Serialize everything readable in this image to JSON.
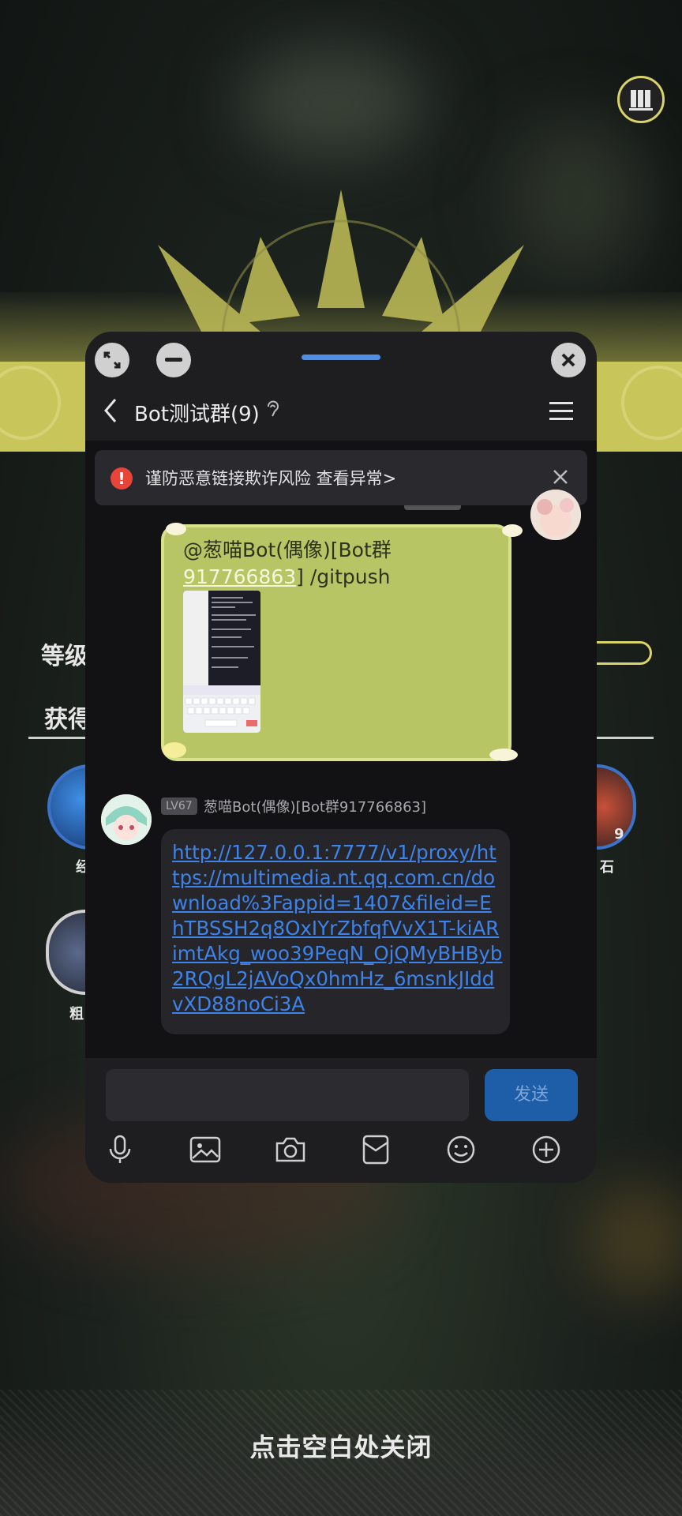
{
  "background": {
    "title_partial": "等级",
    "subtitle_partial": "获得",
    "item_label_1": "经",
    "item_label_2": "粗",
    "item_label_3": "石",
    "item_count": "9",
    "close_hint": "点击空白处关闭"
  },
  "chat": {
    "title": "Bot测试群(9)",
    "warning": "谨防恶意链接欺诈风险 查看异常>",
    "message1": {
      "text_prefix": "@葱喵Bot(偶像)[Bot群",
      "text_number": "917766863",
      "text_suffix": "] /gitpush"
    },
    "message2": {
      "level": "LV67",
      "sender": "葱喵Bot(偶像)[Bot群917766863]",
      "link": "http://127.0.0.1:7777/v1/proxy/https://multimedia.nt.qq.com.cn/download%3Fappid=1407&fileid=EhTBSSH2q8OxIYrZbfqfVvX1T-kiARimtAkg_woo39PeqN_OjQMyBHByb2RQgL2jAVoQx0hmHz_6msnkJIddvXD88noCi3A"
    },
    "send_label": "发送",
    "input_value": ""
  },
  "colors": {
    "accent_yellow": "#c8c55a",
    "bubble_green": "#b8c564",
    "link_blue": "#3d83ea",
    "send_blue": "#1e5ea8",
    "warning_red": "#e8443a"
  }
}
